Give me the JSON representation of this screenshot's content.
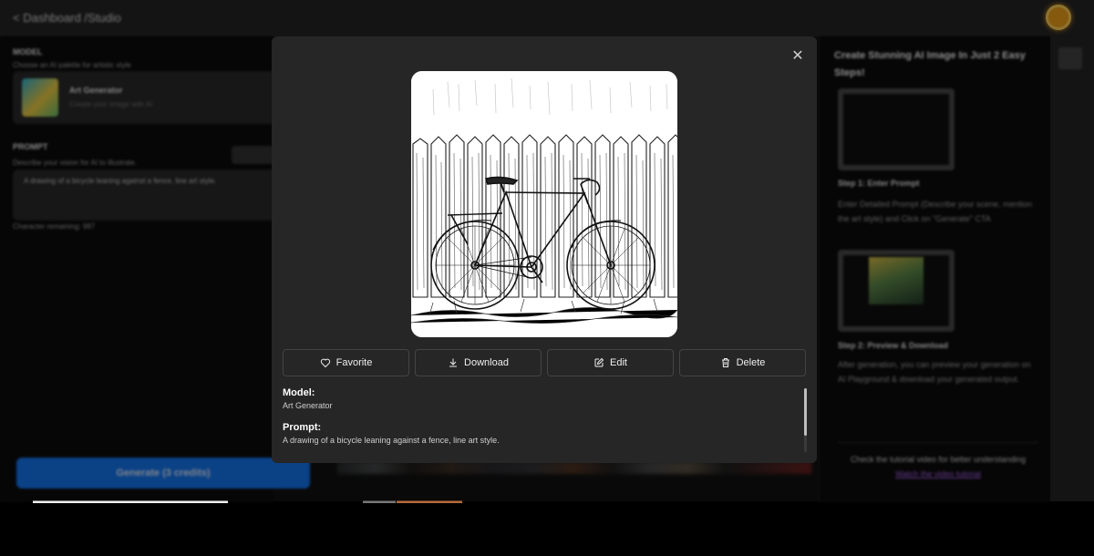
{
  "header": {
    "breadcrumb": "< Dashboard /Studio"
  },
  "left_panel": {
    "model_label": "MODEL",
    "model_hint": "Choose an AI palette for artistic style",
    "model_card_title": "Art Generator",
    "model_card_sub": "Create your image with AI",
    "prompt_label": "PROMPT",
    "prompt_hint": "Describe your vision for AI to illustrate.",
    "prompt_value": "A drawing of a bicycle leaning against a fence, line art style.",
    "chars_remaining": "Character remaining: 987",
    "generate_button": "Generate (3 credits)"
  },
  "right_panel": {
    "title": "Create Stunning AI Image In Just 2 Easy Steps!",
    "step1_title": "Step 1: Enter Prompt",
    "step1_text": "Enter Detailed Prompt (Describe your scene, mention the art style) and Click on \"Generate\" CTA",
    "step2_title": "Step 2: Preview & Download",
    "step2_text": "After generation, you can preview your generation on AI Playground & download your generated output.",
    "tutorial_text": "Check the tutorial video for better understanding",
    "tutorial_link": "Watch the video tutorial"
  },
  "modal": {
    "close_icon": "close-icon",
    "image_alt": "Line art drawing of a bicycle leaning against a wooden fence",
    "actions": [
      {
        "label": "Favorite",
        "icon": "heart-icon"
      },
      {
        "label": "Download",
        "icon": "download-icon"
      },
      {
        "label": "Edit",
        "icon": "edit-icon"
      },
      {
        "label": "Delete",
        "icon": "trash-icon"
      }
    ],
    "model_label": "Model:",
    "model_value": "Art Generator",
    "prompt_label": "Prompt:",
    "prompt_value": "A drawing of a bicycle leaning against a fence, line art style."
  },
  "colors": {
    "accent_blue": "#1477f2",
    "avatar_orange": "#f3a41a",
    "modal_bg": "#262626"
  }
}
